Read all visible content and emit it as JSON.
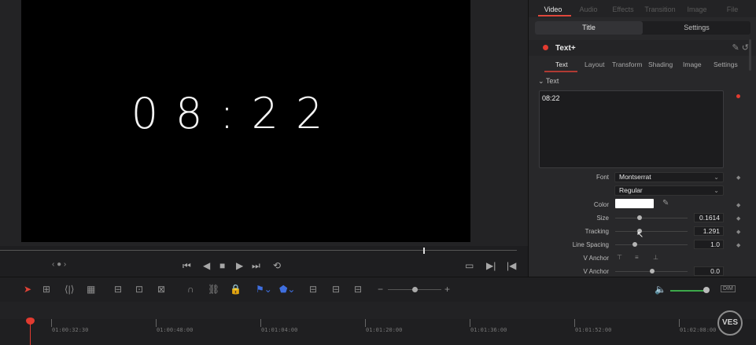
{
  "viewer": {
    "preview_text": "08:22"
  },
  "inspector": {
    "tabs": [
      {
        "label": "Video",
        "active": true
      },
      {
        "label": "Audio"
      },
      {
        "label": "Effects"
      },
      {
        "label": "Transition"
      },
      {
        "label": "Image"
      },
      {
        "label": "File"
      }
    ],
    "segment": {
      "left": "Title",
      "right": "Settings"
    },
    "plugin_title": "Text+",
    "subtabs": [
      "Text",
      "Layout",
      "Transform",
      "Shading",
      "Image",
      "Settings"
    ],
    "section": "Text",
    "text_value": "08:22",
    "font_label": "Font",
    "font_value": "Montserrat",
    "style_value": "Regular",
    "color_label": "Color",
    "color_value": "#ffffff",
    "size_label": "Size",
    "size_value": "0.1614",
    "tracking_label": "Tracking",
    "tracking_value": "1.291",
    "line_spacing_label": "Line Spacing",
    "line_spacing_value": "1.0",
    "v_anchor_label": "V Anchor",
    "v_anchor2_label": "V Anchor",
    "v_anchor2_value": "0.0"
  },
  "timeline": {
    "timecodes": [
      "01:00:32:30",
      "01:00:48:00",
      "01:01:04:00",
      "01:01:20:00",
      "01:01:36:00",
      "01:01:52:00",
      "01:02:08:00"
    ]
  },
  "badge": "VES",
  "colors": {
    "accent": "#e23b30",
    "flag": "#3f6fe0",
    "audio": "#3ca84a"
  }
}
